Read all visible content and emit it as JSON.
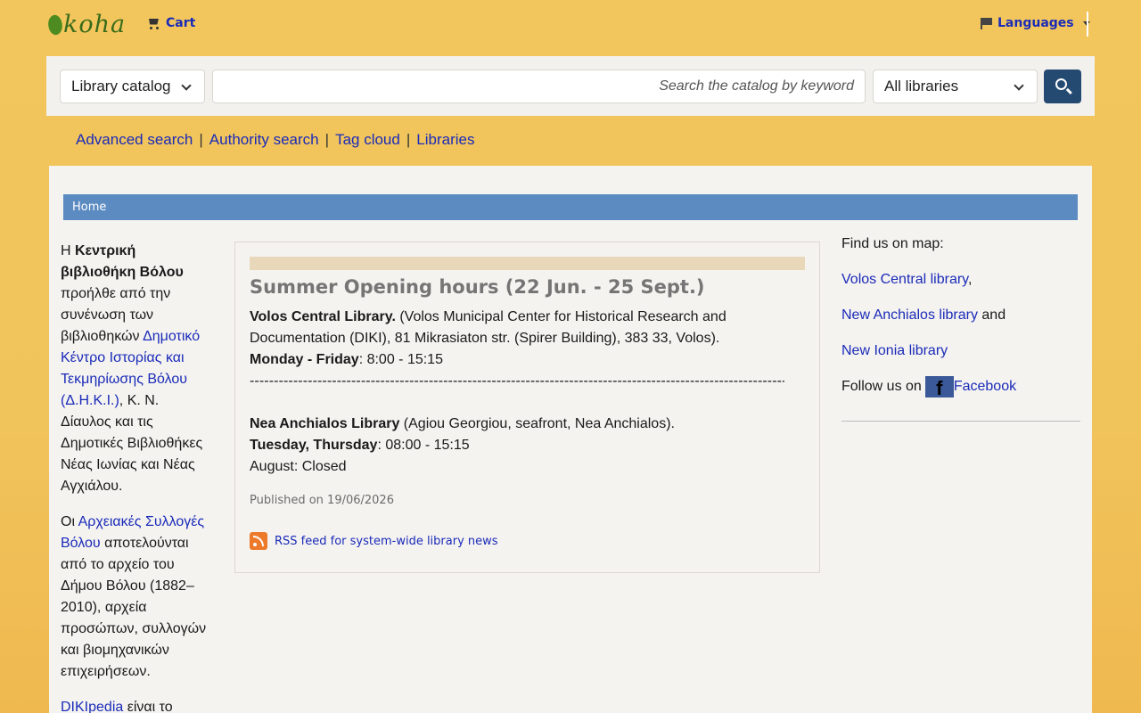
{
  "header": {
    "logo": "koha",
    "cart_label": "Cart",
    "languages_label": "Languages"
  },
  "search": {
    "catalog_select": "Library catalog",
    "placeholder": "Search the catalog by keyword",
    "libraries_select": "All libraries"
  },
  "sublinks": [
    "Advanced search",
    "Authority search",
    "Tag cloud",
    "Libraries"
  ],
  "breadcrumb": "Home",
  "left": {
    "p1_a": "Η ",
    "p1_b": "Κεντρική βιβλιοθήκη Βόλου",
    "p1_c": " προήλθε από την συνένωση των βιβλιοθηκών ",
    "p1_link": "Δημοτικό Κέντρο Ιστορίας και Τεκμηρίωσης Βόλου (Δ.Η.Κ.Ι.)",
    "p1_d": ", Κ. Ν. Δίαυλος και τις Δημοτικές Βιβλιοθήκες Νέας Ιωνίας και Νέας Αγχιάλου.",
    "p2_a": "Οι ",
    "p2_link": "Αρχειακές Συλλογές Βόλου",
    "p2_b": " αποτελούνται από το αρχείο του Δήμου Βόλου (1882–2010), αρχεία προσώπων, συλλογών και βιομηχανικών επιχειρήσεων.",
    "p3_link": "DIKIpedia",
    "p3_b": " είναι το"
  },
  "news": {
    "title": "Summer Opening hours (22 Jun. - 25 Sept.)",
    "volos_name": "Volos Central Library.",
    "volos_addr": " (Volos Municipal Center for Historical Research and Documentation (DIKI), 81 Mikrasiaton str. (Spirer Building), 383 33, Volos).",
    "volos_days": "Monday - Friday",
    "volos_hours": ": 8:00 - 15:15",
    "separator": "------------------------------------------------------------------------------------------------------------------",
    "nea_name": "Nea Anchialos Library",
    "nea_addr": " (Agiou Georgiou, seafront, Nea Anchialos).",
    "nea_days": "Tuesday, Thursday",
    "nea_hours": ": 08:00 - 15:15",
    "nea_august": "August: Closed",
    "published": "Published on 19/06/2026",
    "rss": "RSS feed for system-wide library news"
  },
  "right": {
    "find_us": "Find us on map:",
    "volos_link": "Volos Central library",
    "comma": ",",
    "nea_link": "New Anchialos library",
    "and": " and",
    "ionia_link": "New Ionia library",
    "follow": "Follow us on ",
    "facebook": "Facebook"
  },
  "colors": {
    "background": "#f2c65d",
    "accent_button": "#254a72",
    "breadcrumb": "#5b8bc1",
    "link": "#1a2bb8"
  }
}
